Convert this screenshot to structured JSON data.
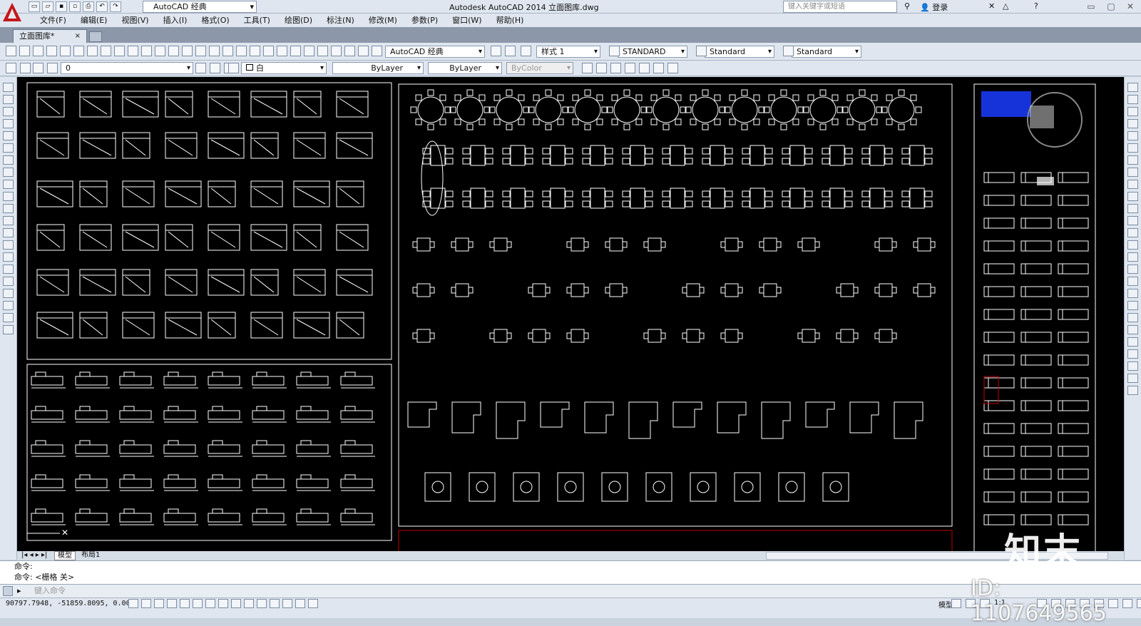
{
  "titlebar": {
    "workspace": "AutoCAD 经典",
    "title": "Autodesk AutoCAD 2014    立面图库.dwg",
    "search_placeholder": "键入关键字或短语",
    "login": "登录",
    "help": "?"
  },
  "menu": [
    "文件(F)",
    "编辑(E)",
    "视图(V)",
    "插入(I)",
    "格式(O)",
    "工具(T)",
    "绘图(D)",
    "标注(N)",
    "修改(M)",
    "参数(P)",
    "窗口(W)",
    "帮助(H)"
  ],
  "doc_tab": {
    "label": "立面图库*",
    "close": "×"
  },
  "toolbar": {
    "workspace": "AutoCAD 经典",
    "style1": "样式 1",
    "text_style": "STANDARD",
    "dim_style": "Standard",
    "table_style": "Standard"
  },
  "props": {
    "layer": "0",
    "color": "白",
    "linetype": "ByLayer",
    "lineweight": "ByLayer",
    "plotstyle": "ByColor"
  },
  "layout_tabs": [
    "模型",
    "布局1"
  ],
  "command": {
    "line1": "命令:",
    "line2": "命令: <栅格 关>",
    "placeholder": "键入命令"
  },
  "status": {
    "coords": "90797.7948,  -51859.8095,  0.0000",
    "model": "模型",
    "scale": "1:1"
  },
  "watermark": {
    "logo": "知末",
    "id": "ID: 1107649565"
  },
  "colors": {
    "canvas": "#000000",
    "lines": "#ffffff",
    "accent": "#c00000",
    "ucs_blue": "#1a3cff"
  }
}
